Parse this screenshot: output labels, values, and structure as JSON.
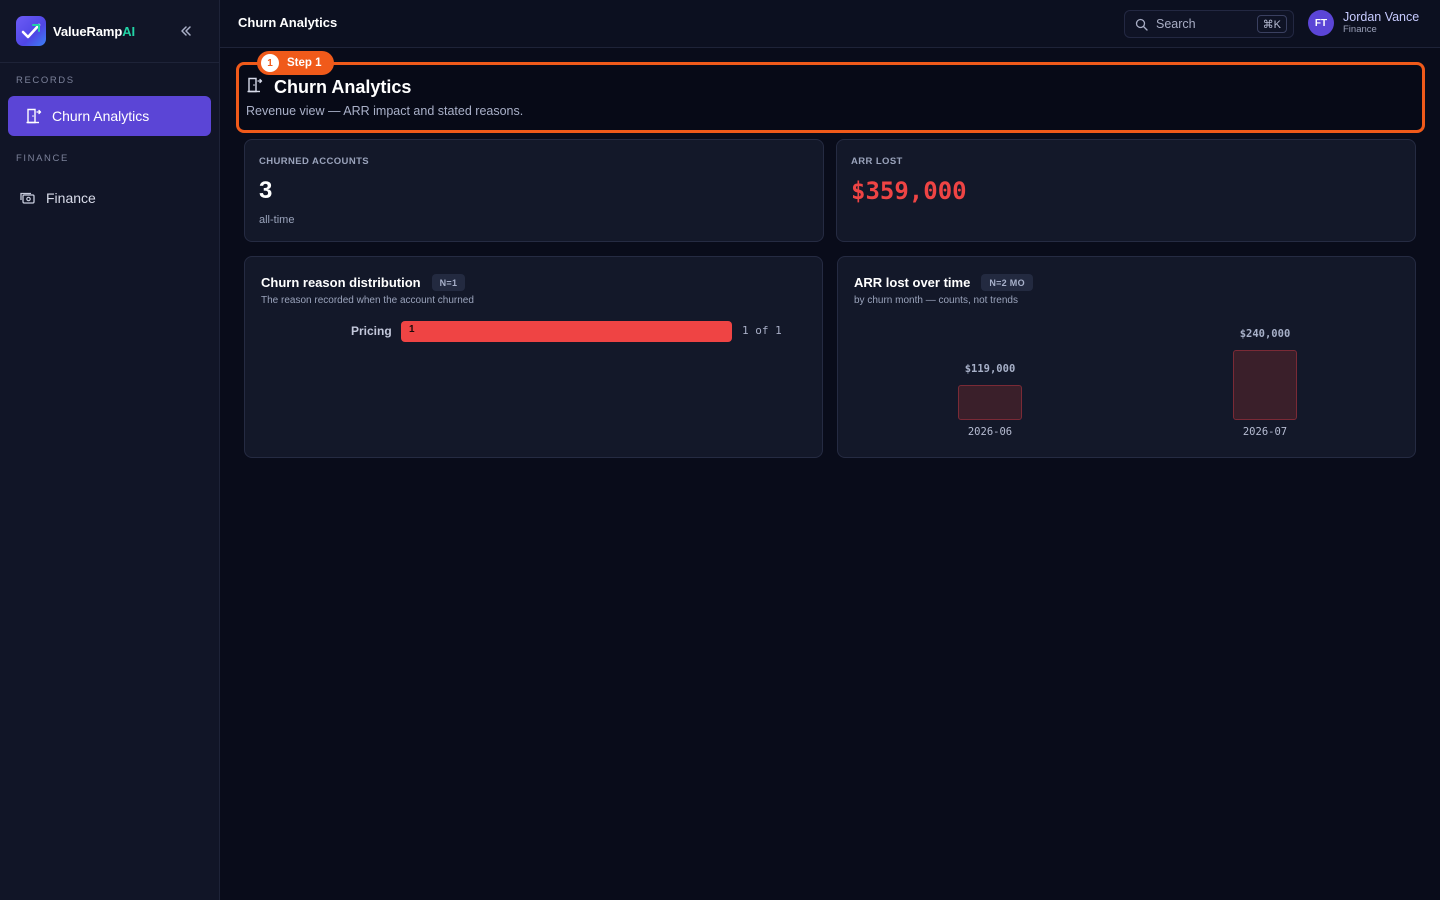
{
  "brand": {
    "name": "ValueRamp",
    "suffix": "AI"
  },
  "sidebar": {
    "sections": [
      {
        "label": "RECORDS",
        "items": [
          {
            "label": "Churn Analytics",
            "icon": "door-exit-icon",
            "active": true
          }
        ]
      },
      {
        "label": "FINANCE",
        "items": [
          {
            "label": "Finance",
            "icon": "cash-icon",
            "active": false
          }
        ]
      }
    ]
  },
  "topbar": {
    "title": "Churn Analytics",
    "search": {
      "placeholder": "Search",
      "shortcut": "⌘K"
    },
    "user": {
      "initials": "FT",
      "name": "Jordan Vance",
      "role": "Finance"
    }
  },
  "page_header": {
    "step": {
      "number": "1",
      "label": "Step 1"
    },
    "title": "Churn Analytics",
    "subtitle": "Revenue view — ARR impact and stated reasons."
  },
  "kpis": {
    "churned": {
      "label": "CHURNED ACCOUNTS",
      "value": "3",
      "sub": "all-time"
    },
    "arr_lost": {
      "label": "ARR LOST",
      "value": "$359,000"
    }
  },
  "reason_panel": {
    "title": "Churn reason distribution",
    "badge": "N=1",
    "subtitle": "The reason recorded when the account churned",
    "rows": [
      {
        "label": "Pricing",
        "inner": "1",
        "count_text": "1 of 1",
        "fraction": 1.0
      }
    ]
  },
  "arr_panel": {
    "title": "ARR lost over time",
    "badge": "N=2 MO",
    "subtitle": "by churn month — counts, not trends"
  },
  "chart_data": {
    "type": "bar",
    "categories": [
      "2026-06",
      "2026-07"
    ],
    "values": [
      119000,
      240000
    ],
    "value_labels": [
      "$119,000",
      "$240,000"
    ],
    "title": "ARR lost over time",
    "xlabel": "",
    "ylabel": "",
    "colors": {
      "bar_fill": "#3a1f2a",
      "bar_stroke": "#7a2a36"
    }
  },
  "colors": {
    "accent": "#5b45d6",
    "highlight": "#f05a1a",
    "negative": "#ef4444",
    "success": "#22d3a5"
  }
}
